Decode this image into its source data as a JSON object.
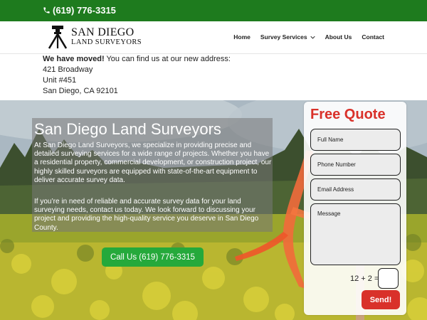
{
  "topbar": {
    "phone": "(619) 776-3315",
    "icon": "phone-icon"
  },
  "header": {
    "logo_line1": "SAN DIEGO",
    "logo_line2": "LAND SURVEYORS",
    "logo_icon": "surveyor-tripod-icon"
  },
  "nav": {
    "items": [
      {
        "label": "Home"
      },
      {
        "label": "Survey Services"
      },
      {
        "label": "About Us"
      },
      {
        "label": "Contact"
      }
    ]
  },
  "notice": {
    "bold": "We have moved!",
    "text": " You can find us at our new address:",
    "address_line1": "421 Broadway",
    "address_line2": "Unit #451",
    "address_line3": "San Diego, CA 92101"
  },
  "hero": {
    "title": "San Diego Land Surveyors",
    "paragraph1": "At San Diego Land Surveyors, we specialize in providing precise and detailed surveying services for a wide range of projects. Whether you have a residential property, commercial development, or construction project, our highly skilled surveyors are equipped with state-of-the-art equipment to deliver accurate survey data.",
    "paragraph2": "If you’re in need of reliable and accurate survey data for your land surveying needs, contact us today. We look forward to discussing your project and providing the high-quality service you deserve in San Diego County.",
    "call_button": "Call Us (619) 776-3315"
  },
  "quote_form": {
    "title": "Free Quote",
    "full_name_placeholder": "Full Name",
    "phone_placeholder": "Phone Number",
    "email_placeholder": "Email Address",
    "message_placeholder": "Message",
    "captcha_label": "12 + 2 =",
    "send_button": "Send!"
  },
  "colors": {
    "topbar_green": "#1e7b1e",
    "call_button_green": "#25a93b",
    "accent_red": "#d9312a"
  }
}
